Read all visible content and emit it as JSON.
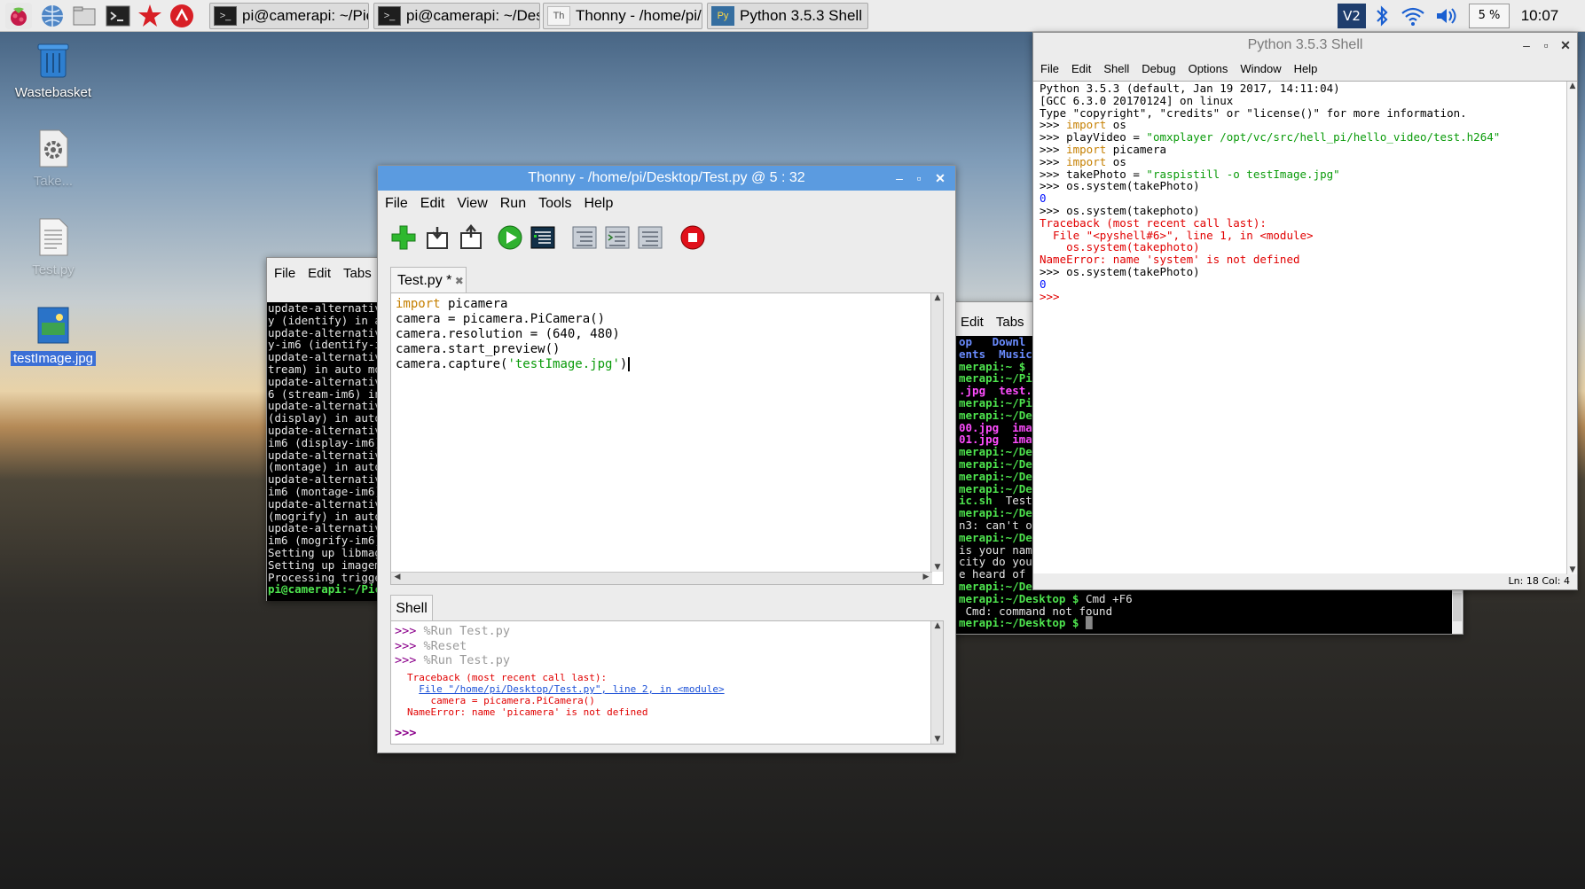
{
  "taskbar": {
    "tasks": [
      {
        "label": "pi@camerapi: ~/Pict..."
      },
      {
        "label": "pi@camerapi: ~/Desk..."
      },
      {
        "label": "Thonny  -  /home/pi/..."
      },
      {
        "label": "Python 3.5.3 Shell"
      }
    ],
    "cpu": "5 %",
    "clock": "10:07",
    "vnc_label": "V2"
  },
  "desktop": {
    "icons": [
      {
        "label": "Wastebasket"
      },
      {
        "label": "Take..."
      },
      {
        "label": "Test.py"
      },
      {
        "label": "testImage.jpg"
      }
    ]
  },
  "term1": {
    "menu": [
      "File",
      "Edit",
      "Tabs"
    ],
    "lines": [
      "update-alternativ",
      "y (identify) in a",
      "update-alternativ",
      "y-im6 (identify-i",
      "update-alternativ",
      "tream) in auto mo",
      "update-alternativ",
      "6 (stream-im6) in",
      "update-alternativ",
      "(display) in auto",
      "update-alternativ",
      "im6 (display-im6)",
      "update-alternativ",
      "(montage) in auto",
      "update-alternativ",
      "im6 (montage-im6)",
      "update-alternativ",
      "(mogrify) in auto",
      "update-alternativ",
      "im6 (mogrify-im6)",
      "Setting up libmag",
      "Setting up imagem",
      "Processing trigge"
    ],
    "prompt": "pi@camerapi:~/Pic"
  },
  "term2": {
    "menu": [
      "Edit",
      "Tabs"
    ],
    "row1a": "op",
    "row1b": "Downl",
    "row2a": "ents",
    "row2b": "Music",
    "lines": [
      {
        "c": "g",
        "t": "merapi:~ $ c"
      },
      {
        "c": "g",
        "t": "merapi:~/Pi"
      },
      {
        "c": "m",
        "t": ".jpg  test."
      },
      {
        "c": "g",
        "t": "merapi:~/Pi"
      },
      {
        "c": "g",
        "t": "merapi:~/De"
      },
      {
        "c": "m",
        "t": "00.jpg  ima"
      },
      {
        "c": "m",
        "t": "01.jpg  ima"
      },
      {
        "c": "g",
        "t": "merapi:~/De"
      },
      {
        "c": "g",
        "t": "merapi:~/De"
      },
      {
        "c": "g",
        "t": "merapi:~/De"
      },
      {
        "c": "g",
        "t": "merapi:~/De"
      },
      {
        "c": "gw",
        "t": "ic.sh",
        "t2": "  Test"
      },
      {
        "c": "g",
        "t": "merapi:~/De"
      },
      {
        "c": "w",
        "t": "n3: can't op"
      },
      {
        "c": "g",
        "t": "merapi:~/De"
      },
      {
        "c": "w",
        "t": "is your name"
      },
      {
        "c": "w",
        "t": "city do you"
      },
      {
        "c": "w",
        "t": "e heard of t"
      },
      {
        "c": "g",
        "t": "merapi:~/De"
      }
    ],
    "bottom1a": "merapi:~/Desktop $",
    "bottom1b": " Cmd +F6",
    "bottom2": " Cmd: command not found",
    "bottom3": "merapi:~/Desktop $"
  },
  "thonny": {
    "title": "Thonny  -  /home/pi/Desktop/Test.py  @  5 : 32",
    "menu": [
      "File",
      "Edit",
      "View",
      "Run",
      "Tools",
      "Help"
    ],
    "tab": "Test.py *",
    "code": {
      "l1_kw": "import",
      "l1_rest": " picamera",
      "l2": "camera = picamera.PiCamera()",
      "l3": "camera.resolution = (640, 480)",
      "l4": "camera.start_preview()",
      "l5_a": "camera.capture(",
      "l5_str": "'testImage.jpg'",
      "l5_b": ")"
    },
    "shell_tab": "Shell",
    "shell": {
      "p": ">>>",
      "c1": " %Run Test.py",
      "c2": " %Reset",
      "c3": " %Run Test.py",
      "tb1": "Traceback (most recent call last):",
      "tb2": "File \"/home/pi/Desktop/Test.py\", line 2, in <module>",
      "tb3": "camera = picamera.PiCamera()",
      "tb4": "NameError: name 'picamera' is not defined"
    }
  },
  "pyshell": {
    "title": "Python 3.5.3 Shell",
    "menu": [
      "File",
      "Edit",
      "Shell",
      "Debug",
      "Options",
      "Window",
      "Help"
    ],
    "l1": "Python 3.5.3 (default, Jan 19 2017, 14:11:04)",
    "l2": "[GCC 6.3.0 20170124] on linux",
    "l3": "Type \"copyright\", \"credits\" or \"license()\" for more information.",
    "p": ">>>",
    "import": "import",
    "os": " os",
    "pv_a": " playVideo = ",
    "pv_str": "\"omxplayer /opt/vc/src/hell_pi/hello_video/test.h264\"",
    "picam": " picamera",
    "tp_a": " takePhoto = ",
    "tp_str": "\"raspistill -o testImage.jpg\"",
    "cmd1": " os.system(takePhoto)",
    "zero": "0",
    "cmd2": " os.system(takephoto)",
    "e1": "Traceback (most recent call last):",
    "e2": "  File \"<pyshell#6>\", line 1, in <module>",
    "e3": "    os.system(takephoto)",
    "e4": "NameError: name 'system' is not defined",
    "cmd3": " os.system(takePhoto)",
    "status": "Ln: 18  Col: 4"
  }
}
